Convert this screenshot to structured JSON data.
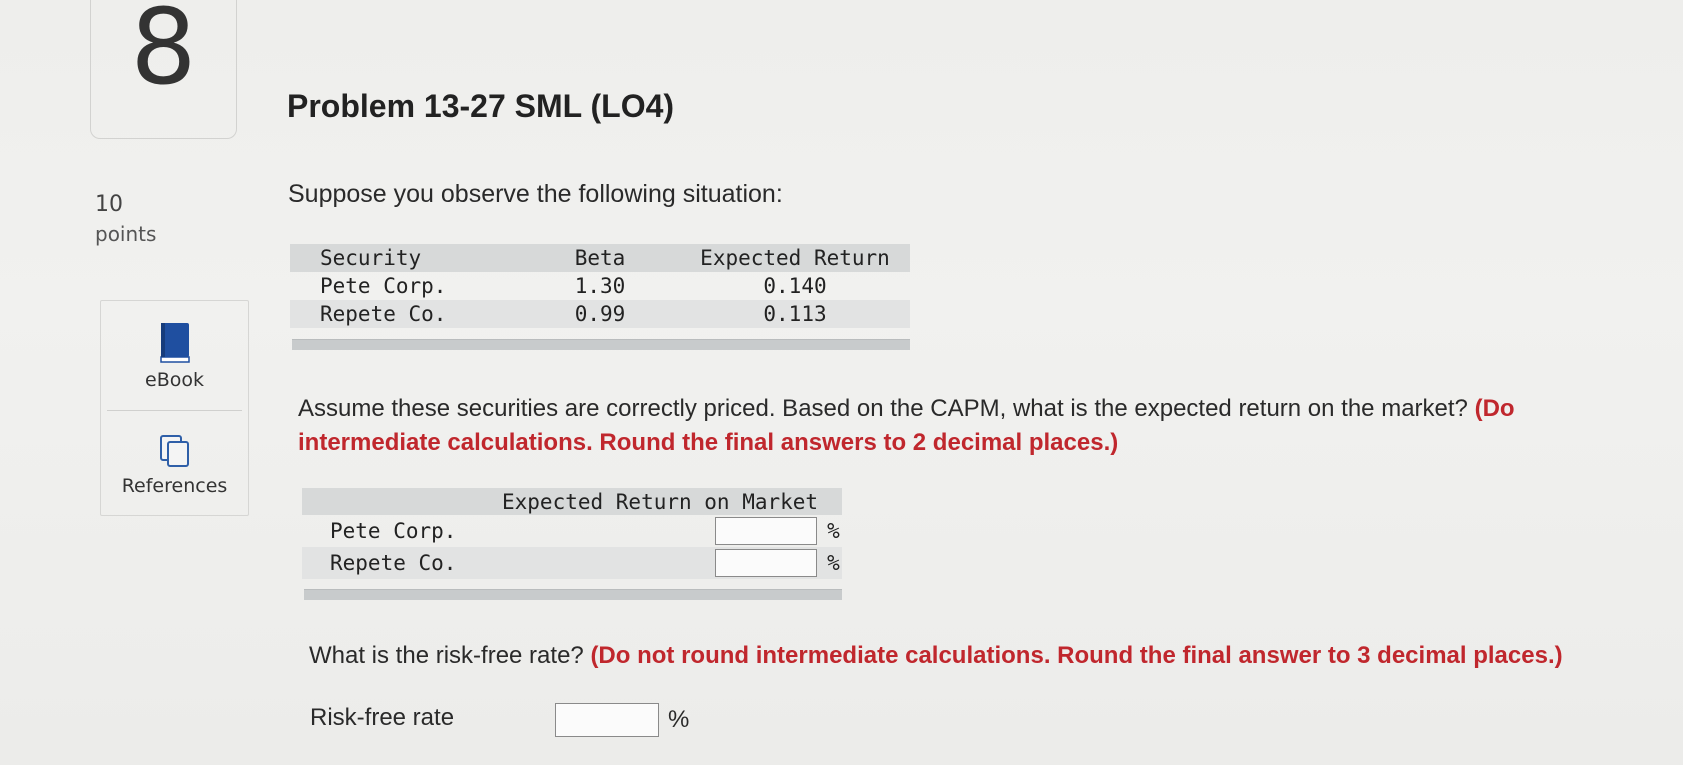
{
  "question": {
    "number": "8",
    "points_value": "10",
    "points_label": "points"
  },
  "sidebar": {
    "ebook_label": "eBook",
    "references_label": "References"
  },
  "problem": {
    "title": "Problem 13-27 SML (LO4)",
    "intro": "Suppose you observe the following situation:"
  },
  "data_table": {
    "headers": [
      "Security",
      "Beta",
      "Expected Return"
    ],
    "rows": [
      [
        "Pete Corp.",
        "1.30",
        "0.140"
      ],
      [
        "Repete Co.",
        "0.99",
        "0.113"
      ]
    ]
  },
  "question1": {
    "text": "Assume these securities are correctly priced. Based on the CAPM, what is the expected return on the market?",
    "instruction_line1": "(Do",
    "instruction_line2": "intermediate calculations. Round the final answers to 2 decimal places.)"
  },
  "answer_table": {
    "header": "Expected Return on Market",
    "rows": [
      {
        "label": "Pete Corp.",
        "value": "",
        "unit": "%"
      },
      {
        "label": "Repete Co.",
        "value": "",
        "unit": "%"
      }
    ]
  },
  "question2": {
    "text": "What is the risk-free rate?",
    "instruction": "(Do not round intermediate calculations. Round the final answer to 3 decimal places.)",
    "field_label": "Risk-free rate",
    "field_value": "",
    "unit": "%"
  },
  "colors": {
    "instruction_red": "#c0272d",
    "table_header_bg": "#d7d9d9",
    "ebook_icon": "#1f4fa0"
  },
  "icons": {
    "ebook": "book-icon",
    "references": "copy-pages-icon"
  }
}
